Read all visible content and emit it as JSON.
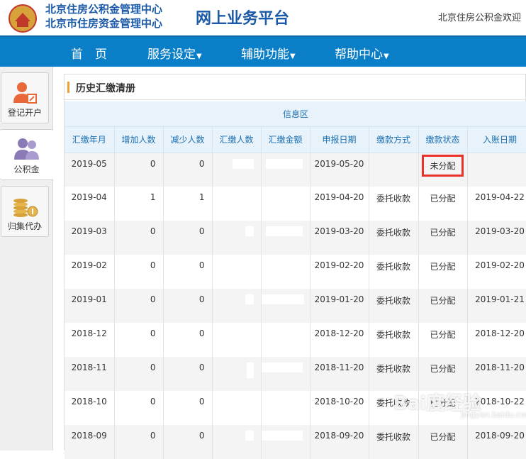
{
  "header": {
    "org_line1": "北京住房公积金管理中心",
    "org_line2": "北京市住房资金管理中心",
    "platform": "网上业务平台",
    "welcome": "北京住房公积金欢迎"
  },
  "nav": {
    "items": [
      {
        "label": "首　页"
      },
      {
        "label": "服务设定"
      },
      {
        "label": "辅助功能"
      },
      {
        "label": "帮助中心"
      }
    ]
  },
  "sidebar": {
    "items": [
      {
        "label": "登记开户",
        "icon": "user-register-icon"
      },
      {
        "label": "公积金",
        "icon": "users-icon"
      },
      {
        "label": "归集代办",
        "icon": "coins-icon"
      }
    ]
  },
  "panel": {
    "title": "历史汇缴清册",
    "info_band": "信息区"
  },
  "table": {
    "headers": [
      "汇缴年月",
      "增加人数",
      "减少人数",
      "汇缴人数",
      "汇缴金额",
      "申报日期",
      "缴款方式",
      "缴款状态",
      "入账日期"
    ],
    "rows": [
      {
        "month": "2019-05",
        "add": "0",
        "reduce": "0",
        "report_date": "2019-05-20",
        "method": "",
        "status": "未分配",
        "post_date": ""
      },
      {
        "month": "2019-04",
        "add": "1",
        "reduce": "1",
        "report_date": "2019-04-20",
        "method": "委托收款",
        "status": "已分配",
        "post_date": "2019-04-22"
      },
      {
        "month": "2019-03",
        "add": "0",
        "reduce": "0",
        "report_date": "2019-03-20",
        "method": "委托收款",
        "status": "已分配",
        "post_date": "2019-03-20"
      },
      {
        "month": "2019-02",
        "add": "0",
        "reduce": "0",
        "report_date": "2019-02-20",
        "method": "委托收款",
        "status": "已分配",
        "post_date": "2019-02-20"
      },
      {
        "month": "2019-01",
        "add": "0",
        "reduce": "0",
        "report_date": "2019-01-20",
        "method": "委托收款",
        "status": "已分配",
        "post_date": "2019-01-21"
      },
      {
        "month": "2018-12",
        "add": "0",
        "reduce": "0",
        "report_date": "2018-12-20",
        "method": "委托收款",
        "status": "已分配",
        "post_date": "2018-12-20"
      },
      {
        "month": "2018-11",
        "add": "0",
        "reduce": "0",
        "report_date": "2018-11-20",
        "method": "委托收款",
        "status": "已分配",
        "post_date": "2018-11-20"
      },
      {
        "month": "2018-10",
        "add": "0",
        "reduce": "0",
        "report_date": "2018-10-20",
        "method": "委托收款",
        "status": "已分配",
        "post_date": "2018-10-22"
      },
      {
        "month": "2018-09",
        "add": "0",
        "reduce": "0",
        "report_date": "2018-09-20",
        "method": "委托收款",
        "status": "已分配",
        "post_date": "2018-09-20"
      }
    ]
  },
  "watermark": {
    "text": "Bai度经验",
    "sub": "jingyan.baidu.com"
  },
  "colors": {
    "brand_blue": "#0a7fc7",
    "header_text": "#1a5aa8",
    "accent_orange": "#f0a030",
    "highlight_red": "#e8312a"
  }
}
